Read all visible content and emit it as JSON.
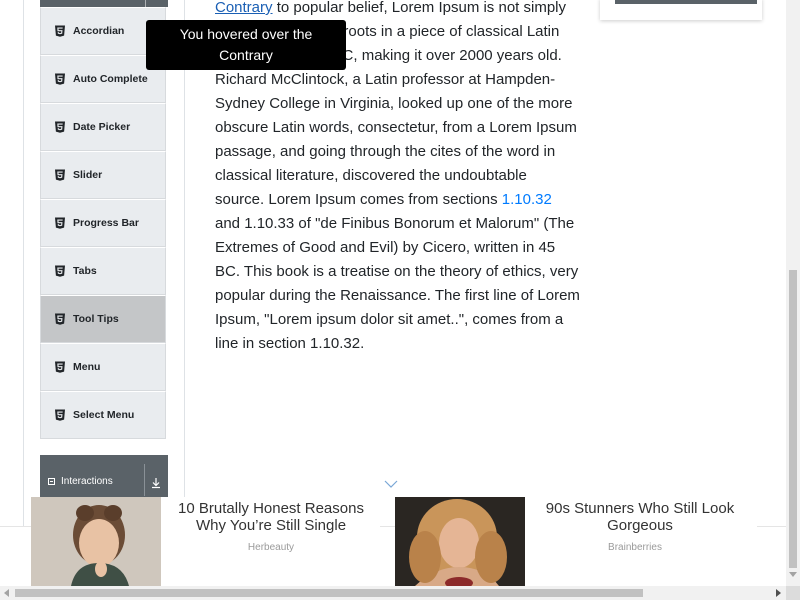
{
  "sidebar": {
    "items": [
      {
        "label": "Accordian",
        "icon": "html5-icon"
      },
      {
        "label": "Auto Complete",
        "icon": "html5-icon"
      },
      {
        "label": "Date Picker",
        "icon": "html5-icon"
      },
      {
        "label": "Slider",
        "icon": "html5-icon"
      },
      {
        "label": "Progress Bar",
        "icon": "html5-icon"
      },
      {
        "label": "Tabs",
        "icon": "html5-icon"
      },
      {
        "label": "Tool Tips",
        "icon": "html5-icon",
        "active": true
      },
      {
        "label": "Menu",
        "icon": "html5-icon"
      },
      {
        "label": "Select Menu",
        "icon": "html5-icon"
      }
    ],
    "next_group": {
      "label": "Interactions",
      "icon": "download-icon"
    }
  },
  "tooltip": {
    "line1": "You hovered over the",
    "line2": "Contrary"
  },
  "content": {
    "link_contrary": "Contrary",
    "text_a": " to popular belief, Lorem Ipsum is not simply random text. It has roots in a piece of classical Latin literature from 45 BC, making it over 2000 years old. Richard McClintock, a Latin professor at Hampden-Sydney College in Virginia, looked up one of the more obscure Latin words, consectetur, from a Lorem Ipsum passage, and going through the cites of the word in classical literature, discovered the undoubtable source. Lorem Ipsum comes from sections ",
    "link_section": "1.10.32",
    "text_b": " and 1.10.33 of \"de Finibus Bonorum et Malorum\" (The Extremes of Good and Evil) by Cicero, written in 45 BC. This book is a treatise on the theory of ethics, very popular during the Renaissance. The first line of Lorem Ipsum, \"Lorem ipsum dolor sit amet..\", comes from a line in section 1.10.32."
  },
  "ads": [
    {
      "title": "10 Brutally Honest Reasons Why You’re Still Single",
      "source": "Herbeauty"
    },
    {
      "title": "90s Stunners Who Still Look Gorgeous",
      "source": "Brainberries"
    }
  ],
  "colors": {
    "accent": "#007bff",
    "sidebar_header": "#5a6268",
    "menu_item": "#e9ecef",
    "menu_item_active": "#c4c6c8"
  }
}
